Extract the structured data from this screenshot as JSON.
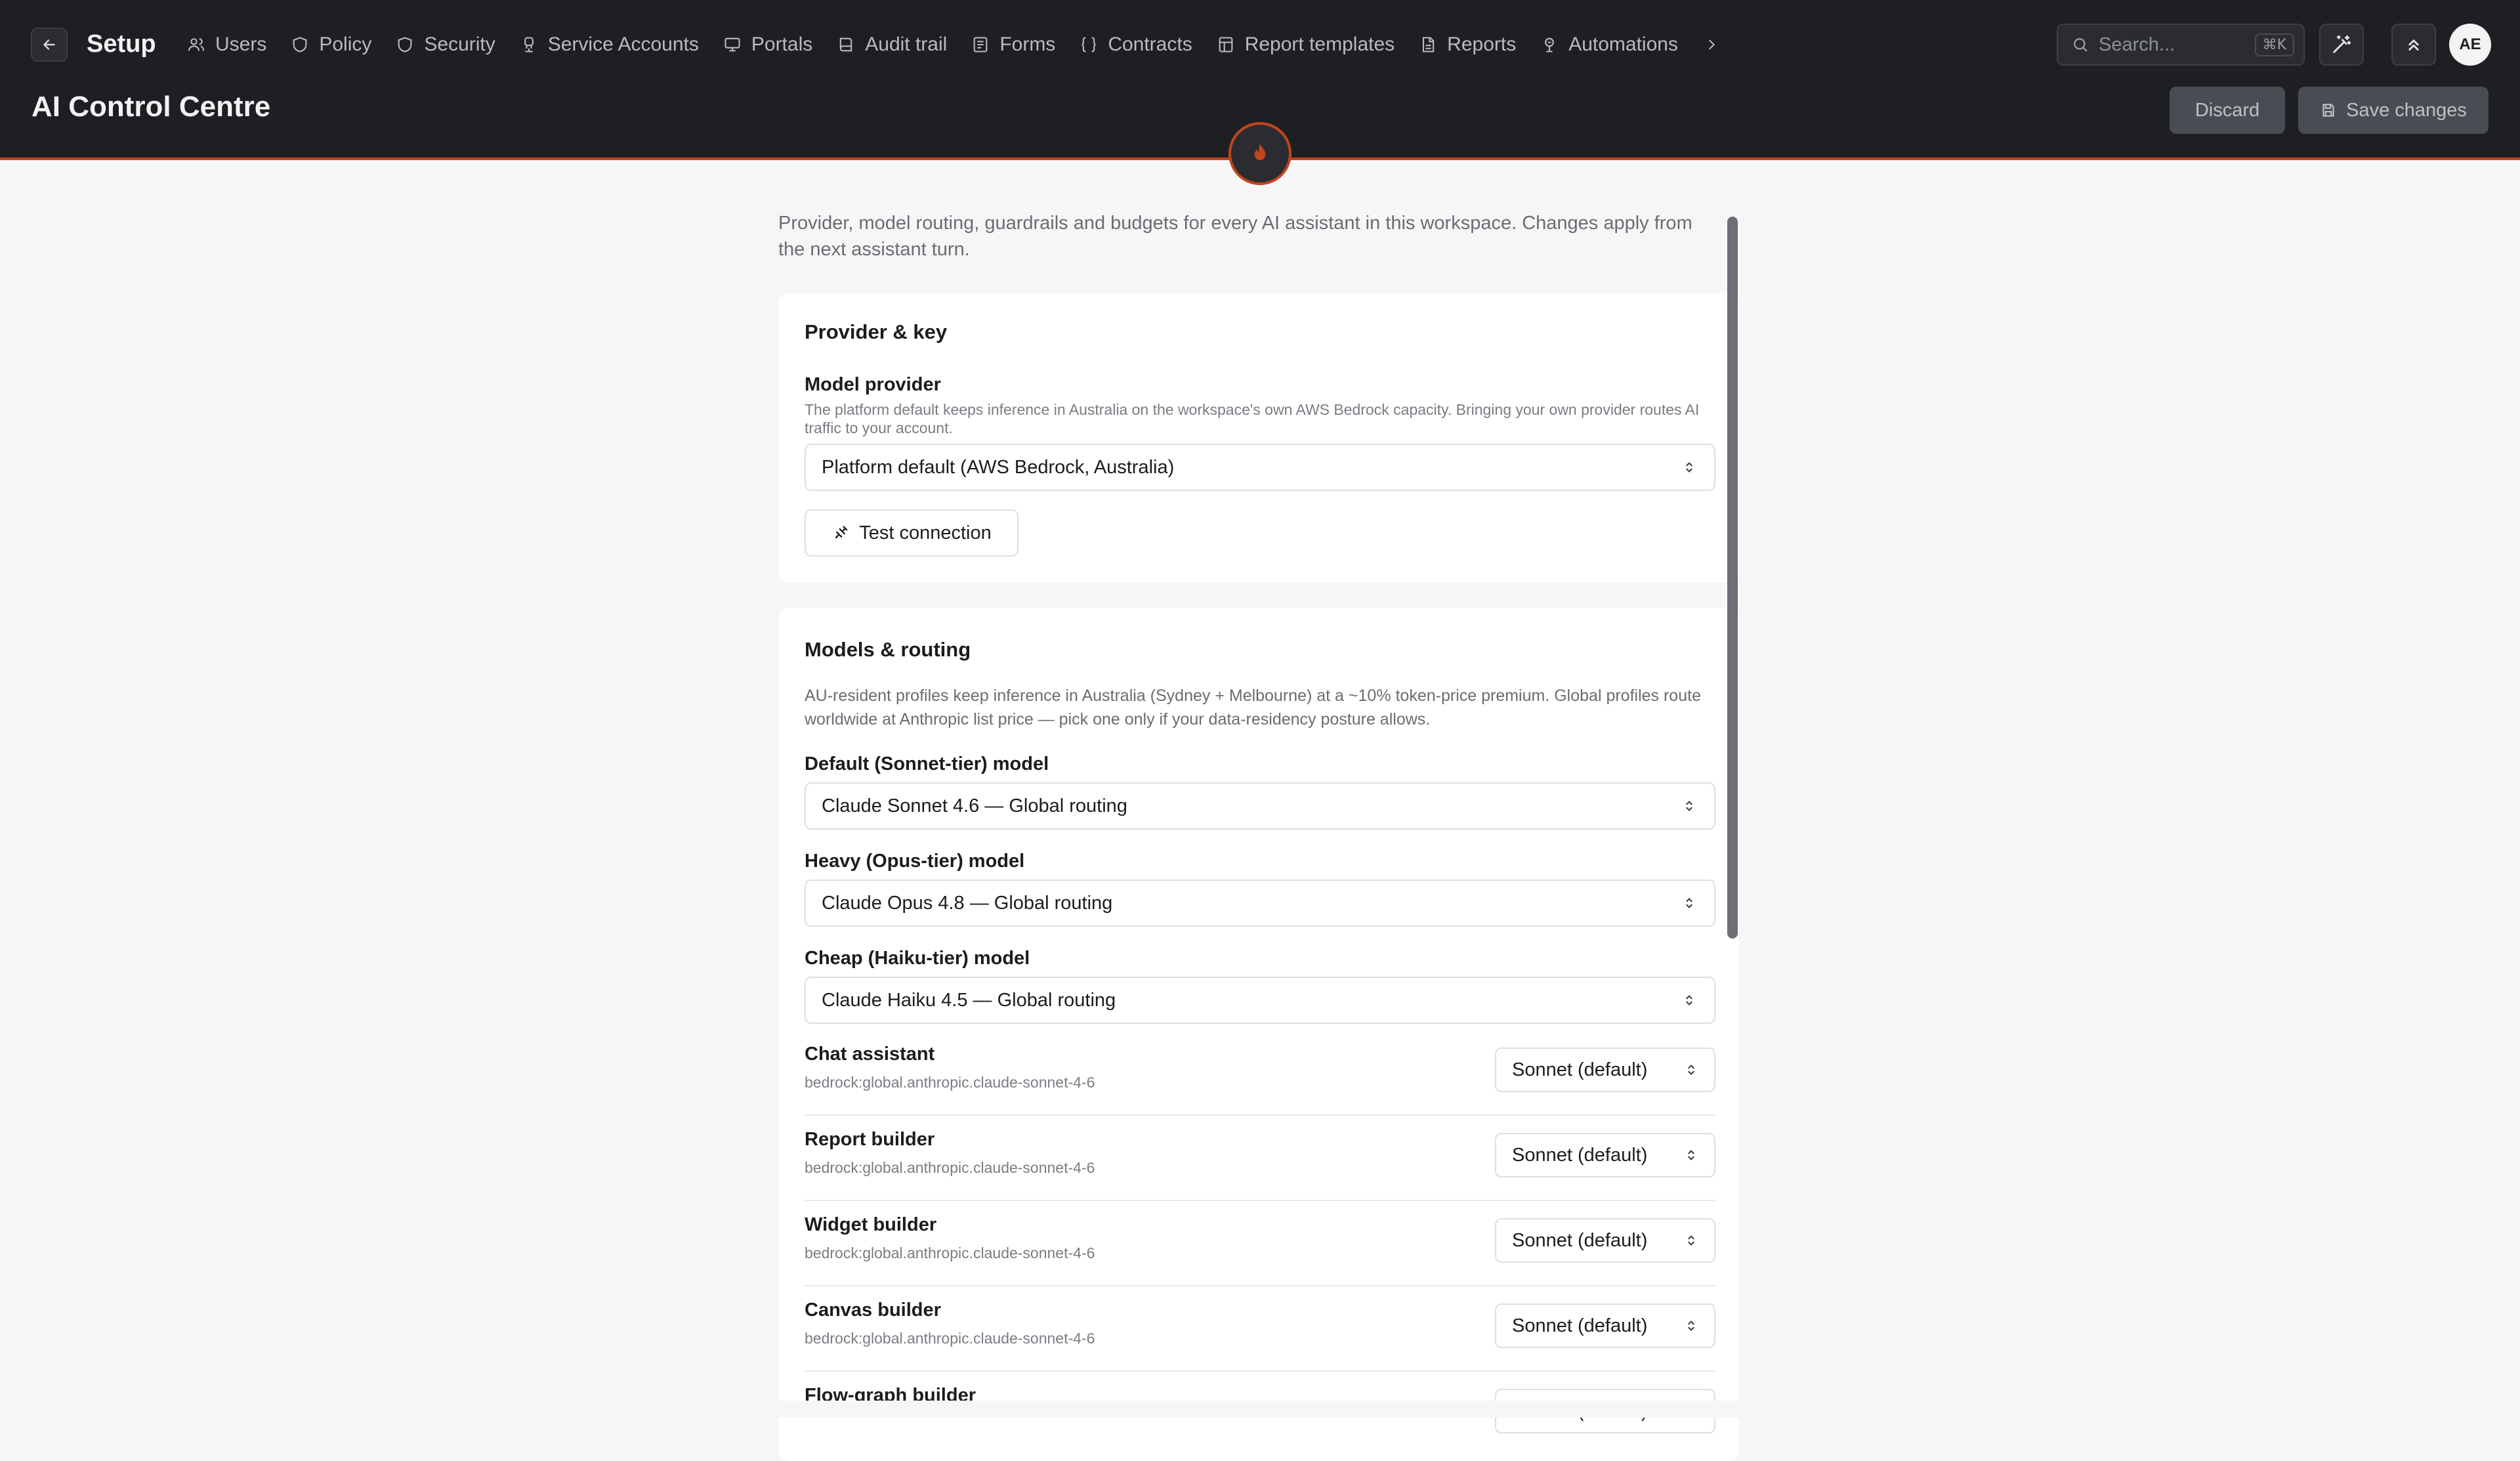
{
  "header": {
    "app_title": "Setup",
    "page_title": "AI Control Centre",
    "nav": [
      {
        "label": "Users",
        "icon": "users-icon"
      },
      {
        "label": "Policy",
        "icon": "policy-icon"
      },
      {
        "label": "Security",
        "icon": "shield-icon"
      },
      {
        "label": "Service Accounts",
        "icon": "service-accounts-icon"
      },
      {
        "label": "Portals",
        "icon": "portal-icon"
      },
      {
        "label": "Audit trail",
        "icon": "audit-icon"
      },
      {
        "label": "Forms",
        "icon": "forms-icon"
      },
      {
        "label": "Contracts",
        "icon": "braces-icon"
      },
      {
        "label": "Report templates",
        "icon": "template-icon"
      },
      {
        "label": "Reports",
        "icon": "report-icon"
      },
      {
        "label": "Automations",
        "icon": "automation-icon"
      }
    ],
    "search_placeholder": "Search...",
    "search_shortcut": "⌘K",
    "avatar_initials": "AE",
    "discard_label": "Discard",
    "save_label": "Save changes",
    "accent_color": "#c2451c"
  },
  "intro": "Provider, model routing, guardrails and budgets for every AI assistant in this workspace. Changes apply from the next assistant turn.",
  "provider_card": {
    "title": "Provider & key",
    "provider_label": "Model provider",
    "provider_help": "The platform default keeps inference in Australia on the workspace's own AWS Bedrock capacity. Bringing your own provider routes AI traffic to your account.",
    "provider_value": "Platform default (AWS Bedrock, Australia)",
    "test_label": "Test connection"
  },
  "routing_card": {
    "title": "Models & routing",
    "help": "AU-resident profiles keep inference in Australia (Sydney + Melbourne) at a ~10% token-price premium. Global profiles route worldwide at Anthropic list price — pick one only if your data-residency posture allows.",
    "default_label": "Default (Sonnet-tier) model",
    "default_value": "Claude Sonnet 4.6 — Global routing",
    "heavy_label": "Heavy (Opus-tier) model",
    "heavy_value": "Claude Opus 4.8 — Global routing",
    "cheap_label": "Cheap (Haiku-tier) model",
    "cheap_value": "Claude Haiku 4.5 — Global routing",
    "assistants": [
      {
        "name": "Chat assistant",
        "model_id": "bedrock:global.anthropic.claude-sonnet-4-6",
        "tier": "Sonnet (default)"
      },
      {
        "name": "Report builder",
        "model_id": "bedrock:global.anthropic.claude-sonnet-4-6",
        "tier": "Sonnet (default)"
      },
      {
        "name": "Widget builder",
        "model_id": "bedrock:global.anthropic.claude-sonnet-4-6",
        "tier": "Sonnet (default)"
      },
      {
        "name": "Canvas builder",
        "model_id": "bedrock:global.anthropic.claude-sonnet-4-6",
        "tier": "Sonnet (default)"
      },
      {
        "name": "Flow-graph builder",
        "model_id": "",
        "tier": "Sonnet (default)"
      }
    ]
  }
}
